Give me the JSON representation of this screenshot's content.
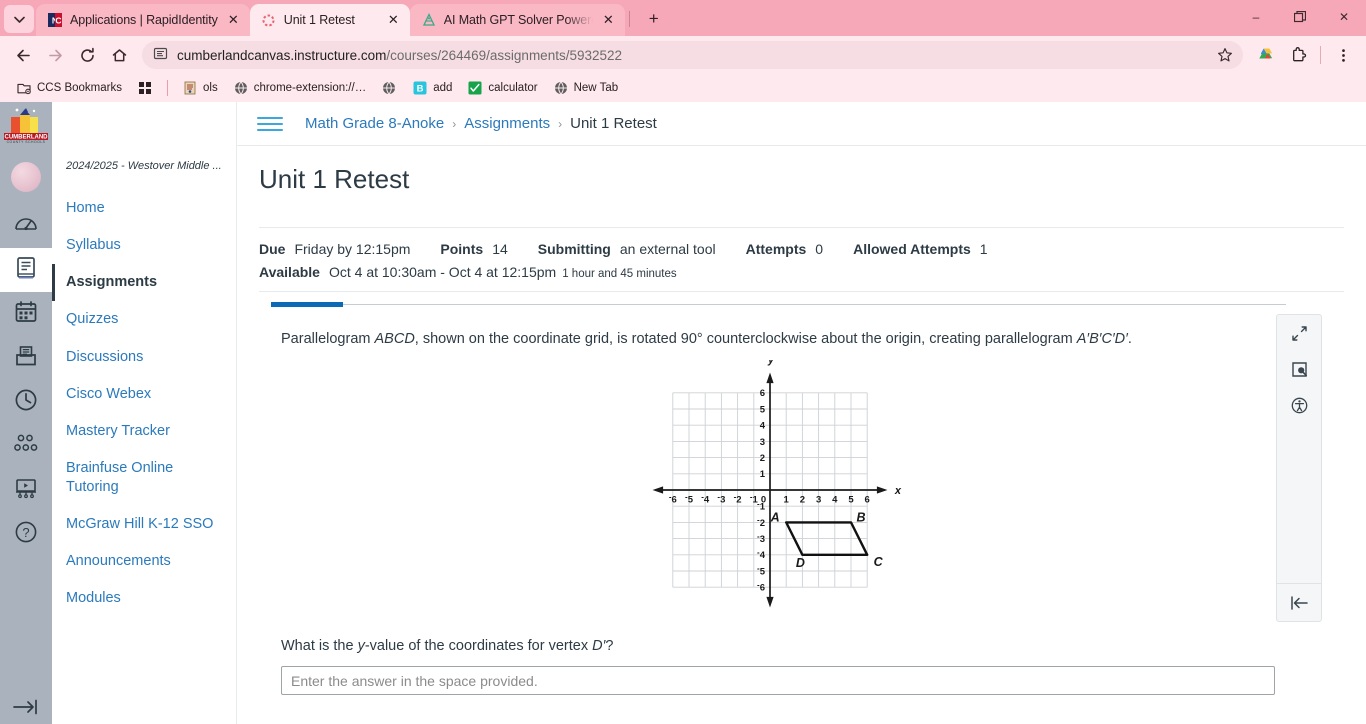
{
  "browser": {
    "tabs": [
      {
        "title": "Applications | RapidIdentity",
        "favicon": "nc-logo-icon",
        "active": false
      },
      {
        "title": "Unit 1 Retest",
        "favicon": "canvas-loading-icon",
        "active": true
      },
      {
        "title": "AI Math GPT Solver Powered by",
        "favicon": "math-gpt-icon",
        "active": false
      }
    ],
    "tab_list_label": "⌄",
    "new_tab_label": "+",
    "close_label": "✕",
    "window_controls": {
      "minimize": "–",
      "maximize": "❐",
      "close": "✕"
    },
    "nav": {
      "back": "←",
      "forward": "→",
      "reload": "↻",
      "home": "⌂"
    },
    "url": {
      "host": "cumberlandcanvas.instructure.com",
      "path": "/courses/264469/assignments/5932522",
      "site_icon": "page-info-icon",
      "star_icon": "bookmark-star-icon"
    },
    "toolbar_right": [
      {
        "name": "google-drive-icon",
        "glyph": "△"
      },
      {
        "name": "extensions-icon",
        "glyph": "⬚"
      },
      {
        "name": "browser-menu-icon",
        "glyph": "⋮"
      }
    ],
    "bookmarks": [
      {
        "label": "CCS Bookmarks",
        "icon": "folder-settings-icon"
      },
      {
        "label": "",
        "icon": "apps-grid-icon"
      },
      {
        "label": "ols",
        "icon": "site-icon"
      },
      {
        "label": "chrome-extension://…",
        "icon": "globe-icon"
      },
      {
        "label": "",
        "icon": "globe-icon"
      },
      {
        "label": "add",
        "icon": "b-square-icon"
      },
      {
        "label": "calculator",
        "icon": "calculator-icon"
      },
      {
        "label": "New Tab",
        "icon": "globe-icon"
      }
    ]
  },
  "globalnav": {
    "logo_text_top": "CUMBERLAND",
    "logo_text_bottom": "COUNTY SCHOOLS",
    "items": [
      {
        "name": "account-avatar",
        "label": "Account"
      },
      {
        "name": "dashboard-icon",
        "label": "Dashboard"
      },
      {
        "name": "courses-icon",
        "label": "Courses"
      },
      {
        "name": "calendar-icon",
        "label": "Calendar"
      },
      {
        "name": "inbox-icon",
        "label": "Inbox"
      },
      {
        "name": "history-icon",
        "label": "History"
      },
      {
        "name": "groups-icon",
        "label": "Groups"
      },
      {
        "name": "studio-icon",
        "label": "Studio"
      },
      {
        "name": "help-icon",
        "label": "Help"
      }
    ],
    "collapse_label": "→|"
  },
  "coursenav": {
    "term": "2024/2025 - Westover Middle ...",
    "items": [
      {
        "label": "Home",
        "active": false
      },
      {
        "label": "Syllabus",
        "active": false
      },
      {
        "label": "Assignments",
        "active": true
      },
      {
        "label": "Quizzes",
        "active": false
      },
      {
        "label": "Discussions",
        "active": false
      },
      {
        "label": "Cisco Webex",
        "active": false
      },
      {
        "label": "Mastery Tracker",
        "active": false
      },
      {
        "label": "Brainfuse Online Tutoring",
        "active": false
      },
      {
        "label": "McGraw Hill K-12 SSO",
        "active": false
      },
      {
        "label": "Announcements",
        "active": false
      },
      {
        "label": "Modules",
        "active": false
      }
    ]
  },
  "breadcrumb": {
    "items": [
      "Math Grade 8-Anoke",
      "Assignments",
      "Unit 1 Retest"
    ],
    "separator": "›"
  },
  "assignment": {
    "title": "Unit 1 Retest",
    "due_label": "Due",
    "due_value": "Friday by 12:15pm",
    "points_label": "Points",
    "points_value": "14",
    "submitting_label": "Submitting",
    "submitting_value": "an external tool",
    "attempts_label": "Attempts",
    "attempts_value": "0",
    "allowed_attempts_label": "Allowed Attempts",
    "allowed_attempts_value": "1",
    "available_label": "Available",
    "available_value": "Oct 4 at 10:30am - Oct 4 at 12:15pm",
    "available_duration": "1 hour and 45 minutes"
  },
  "quiz": {
    "progress_percent": 7,
    "question_text_parts": {
      "p1": "Parallelogram ",
      "abcd": "ABCD",
      "p2": ", shown on the coordinate grid, is rotated 90° counterclockwise about the origin, creating parallelogram ",
      "aprime": "A′B′C′D′",
      "p3": "."
    },
    "prompt_parts": {
      "p1": "What is the ",
      "yvar": "y",
      "p2": "-value of the coordinates for vertex ",
      "dprime": "D′",
      "p3": "?"
    },
    "answer_value": "",
    "answer_placeholder": "Enter the answer in the space provided.",
    "rail": [
      {
        "name": "fullscreen-icon",
        "label": "Toggle fullscreen"
      },
      {
        "name": "magnifier-tool-icon",
        "label": "Zoom tool"
      },
      {
        "name": "accessibility-icon",
        "label": "Accessibility"
      }
    ],
    "rail_collapse": {
      "name": "collapse-rail-icon",
      "label": "⇤"
    }
  },
  "chart_data": {
    "type": "scatter",
    "title": "",
    "xlabel": "x",
    "ylabel": "y",
    "xlim": [
      -6.5,
      6.5
    ],
    "ylim": [
      -6.5,
      6.5
    ],
    "xticks": [
      "-6",
      "-5",
      "-4",
      "-3",
      "-2",
      "-1",
      "0",
      "1",
      "2",
      "3",
      "4",
      "5",
      "6"
    ],
    "yticks": [
      "6",
      "5",
      "4",
      "3",
      "2",
      "1",
      "-1",
      "-2",
      "-3",
      "-4",
      "-5",
      "-6"
    ],
    "grid": true,
    "origin_label": "0",
    "shapes": [
      {
        "name": "parallelogram-ABCD",
        "vertices": [
          {
            "label": "A",
            "x": 1,
            "y": -2,
            "label_pos": "left"
          },
          {
            "label": "B",
            "x": 5,
            "y": -2,
            "label_pos": "right"
          },
          {
            "label": "C",
            "x": 6,
            "y": -4,
            "label_pos": "right-below"
          },
          {
            "label": "D",
            "x": 2,
            "y": -4,
            "label_pos": "below"
          }
        ]
      }
    ]
  },
  "colors": {
    "accent_blue": "#2b7abc",
    "canvas_dark": "#2d3b45",
    "progress_blue": "#0a6ab5",
    "browser_pink": "#f7a8b8",
    "nav_gray": "#a9b2bd"
  }
}
